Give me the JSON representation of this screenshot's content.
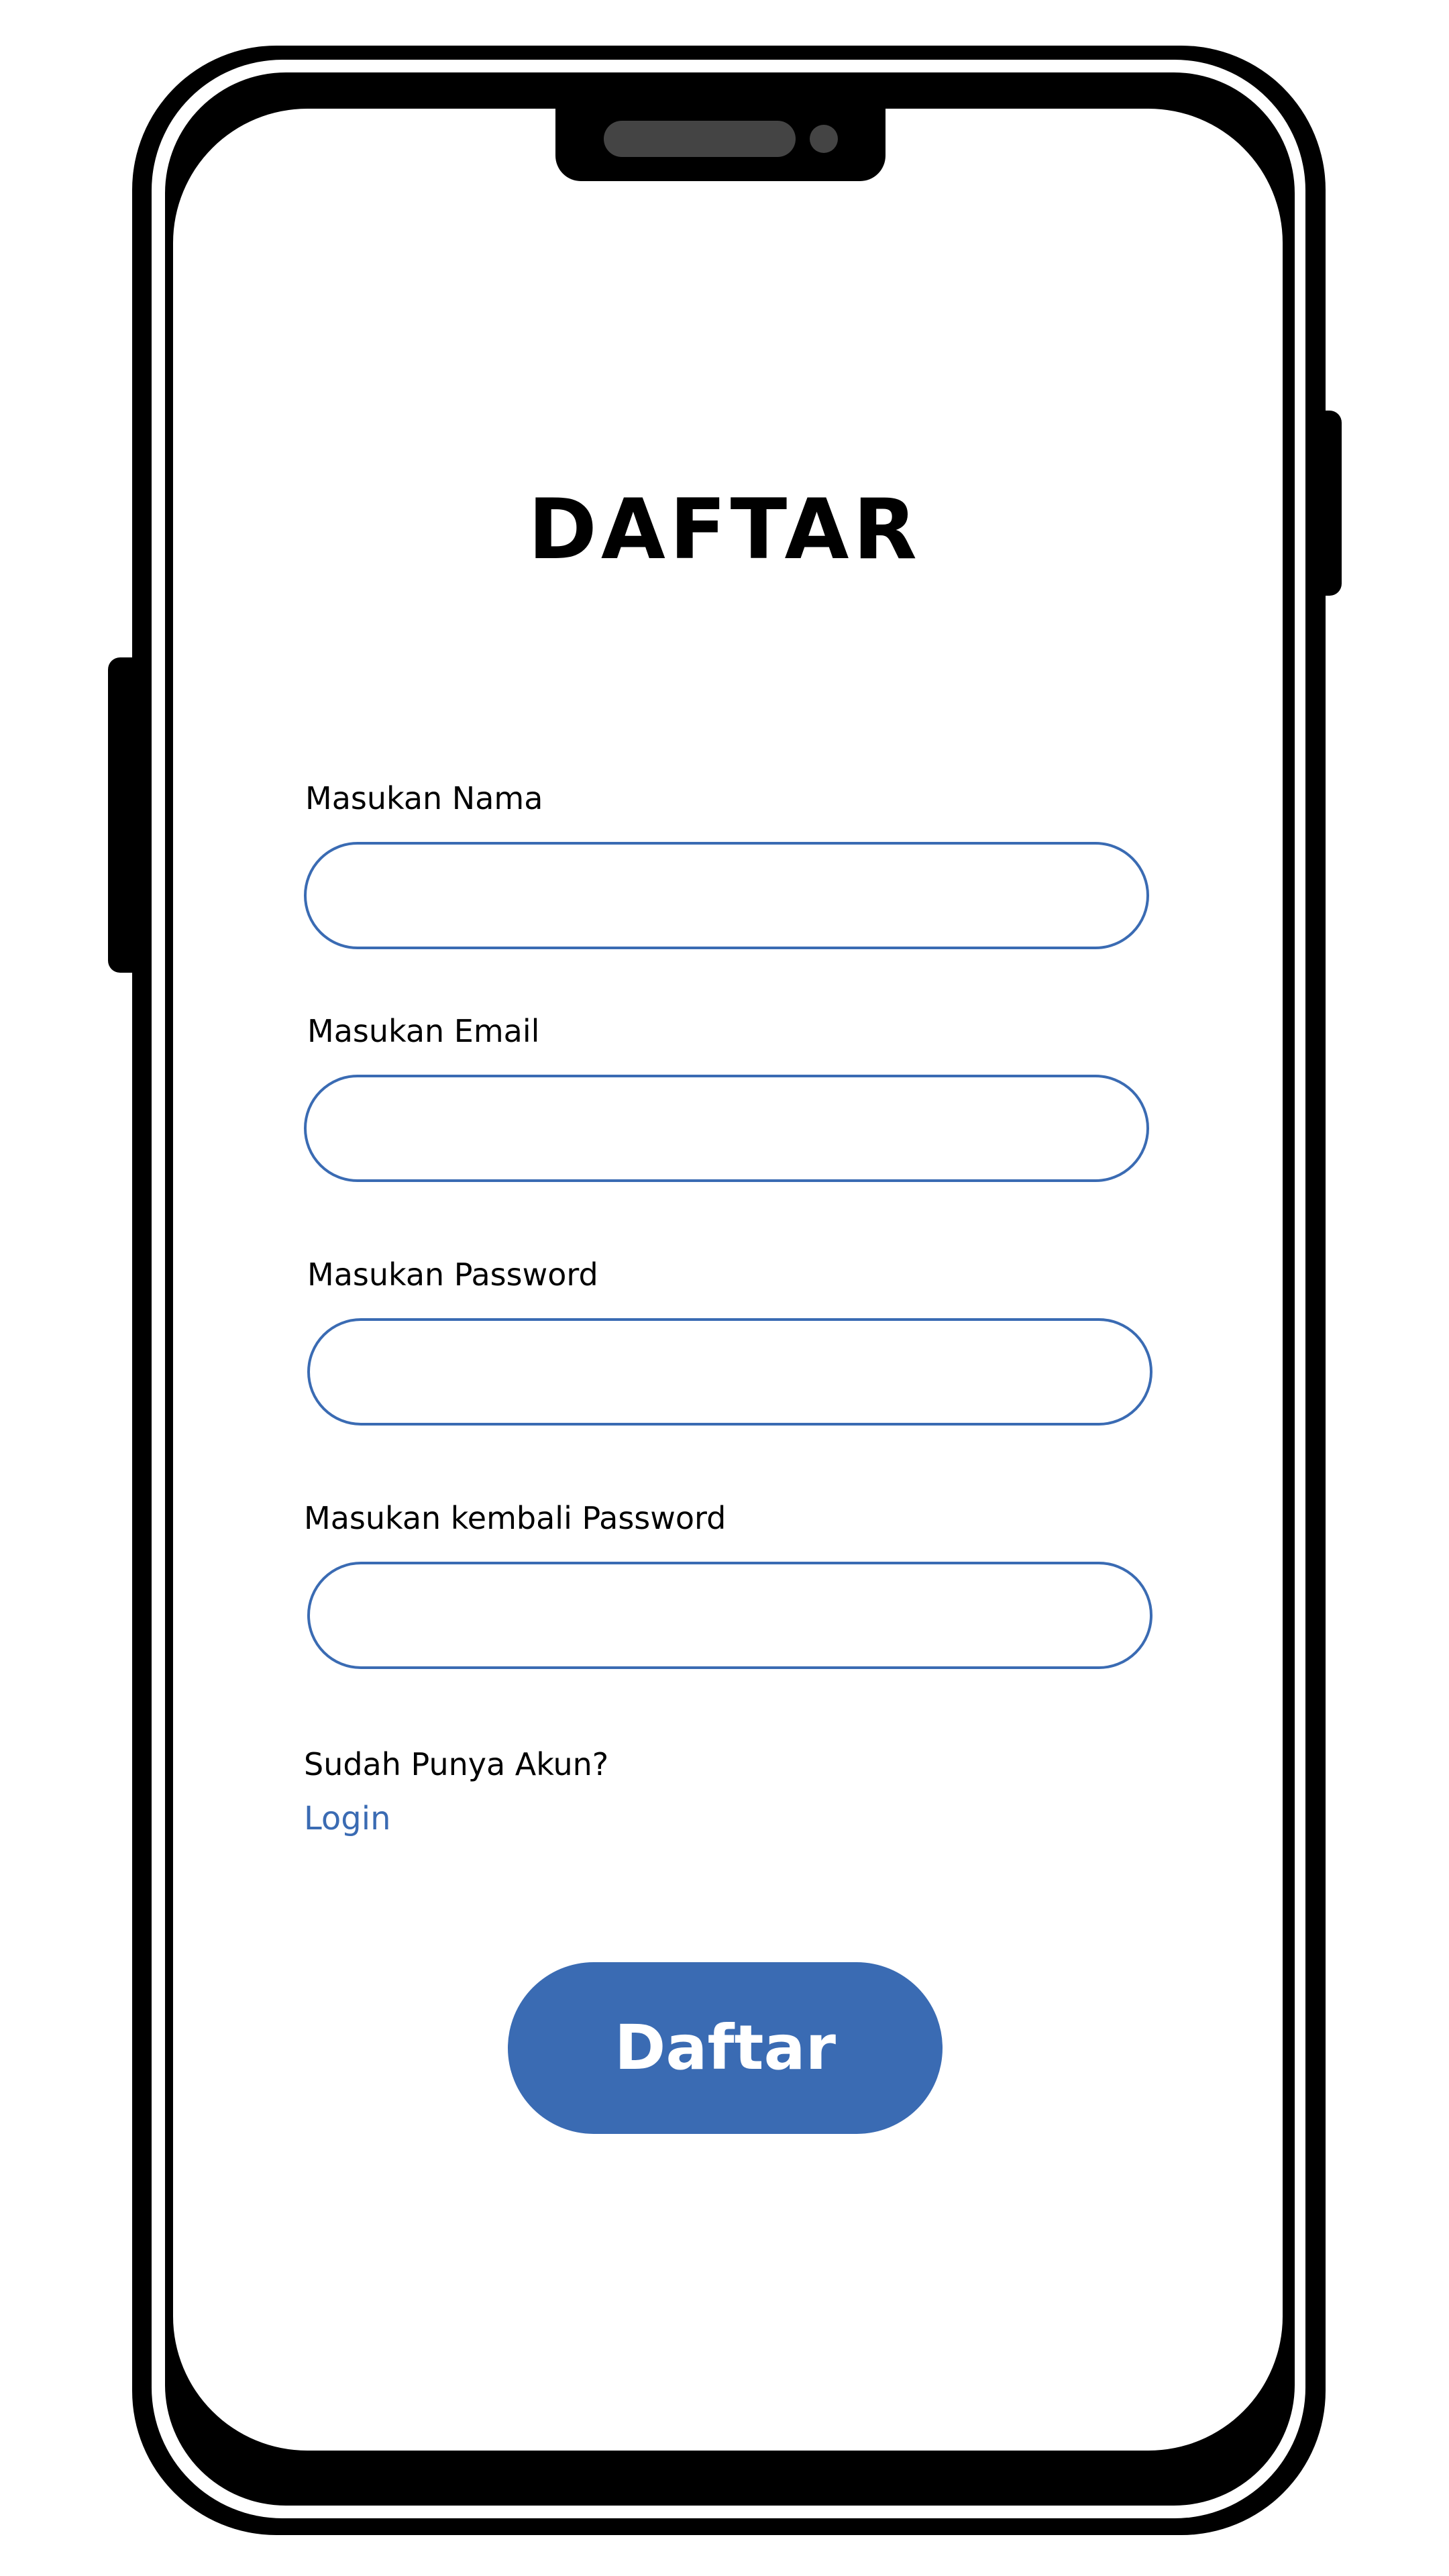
{
  "page": {
    "title": "DAFTAR"
  },
  "form": {
    "fields": [
      {
        "label": "Masukan Nama",
        "value": "",
        "placeholder": ""
      },
      {
        "label": "Masukan Email",
        "value": "",
        "placeholder": ""
      },
      {
        "label": "Masukan Password",
        "value": "",
        "placeholder": ""
      },
      {
        "label": "Masukan kembali Password",
        "value": "",
        "placeholder": ""
      }
    ],
    "login_prompt": "Sudah Punya Akun?",
    "login_link": "Login",
    "submit_label": "Daftar"
  },
  "colors": {
    "accent": "#3a6bb3",
    "frame": "#000000",
    "background": "#ffffff"
  }
}
